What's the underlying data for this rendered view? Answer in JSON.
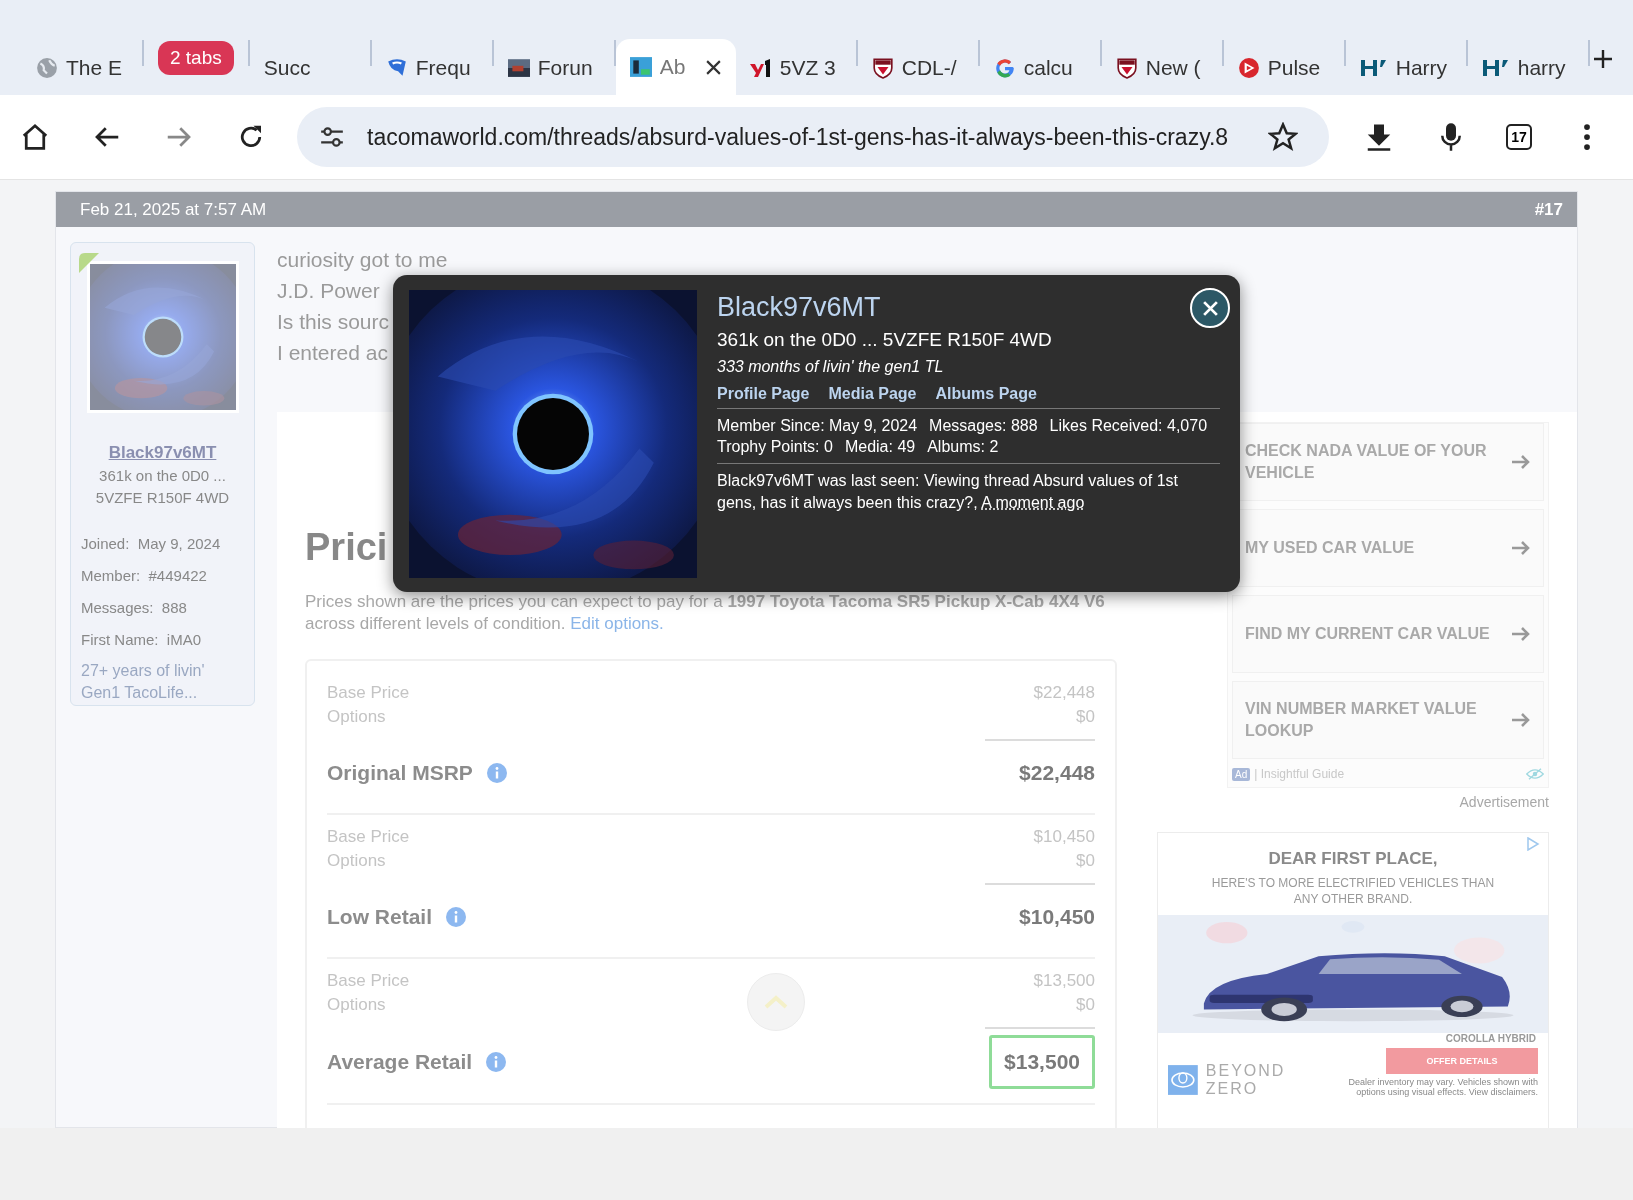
{
  "browser": {
    "tabs": [
      {
        "kind": "tab",
        "title": "The E",
        "selected": false
      },
      {
        "kind": "group",
        "title": "2 tabs",
        "color": "#d93655"
      },
      {
        "kind": "tab",
        "title": "Succ",
        "selected": false
      },
      {
        "kind": "tab",
        "title": "Frequ",
        "selected": false
      },
      {
        "kind": "tab",
        "title": "Forun",
        "selected": false
      },
      {
        "kind": "tab",
        "title": "Ab",
        "selected": true
      },
      {
        "kind": "tab",
        "title": "5VZ 3",
        "selected": false
      },
      {
        "kind": "tab",
        "title": "CDL-/",
        "selected": false
      },
      {
        "kind": "tab",
        "title": "calcu",
        "selected": false
      },
      {
        "kind": "tab",
        "title": "New (",
        "selected": false
      },
      {
        "kind": "tab",
        "title": "Pulse",
        "selected": false
      },
      {
        "kind": "tab",
        "title": "Harry",
        "selected": false
      },
      {
        "kind": "tab",
        "title": "harry",
        "selected": false
      }
    ],
    "url": "tacomaworld.com/threads/absurd-values-of-1st-gens-has-it-always-been-this-crazy.8",
    "tab_count": "17"
  },
  "post": {
    "date": "Feb 21, 2025 at 7:57 AM",
    "number": "#17",
    "user": {
      "name": "Black97v6MT",
      "title": "361k on the 0D0 ... 5VZFE R150F 4WD",
      "stats": [
        {
          "label": "Joined:",
          "value": "May 9, 2024"
        },
        {
          "label": "Member:",
          "value": "#449422"
        },
        {
          "label": "Messages:",
          "value": "888"
        },
        {
          "label": "First Name:",
          "value": "iMA0"
        }
      ],
      "custom_title": "27+ years of livin' Gen1 TacoLife..."
    },
    "lines": [
      "curiosity got to me",
      "J.D. Power",
      "Is this sourc",
      "I entered ac"
    ]
  },
  "pricing": {
    "heading": "Prici",
    "intro": "Prices shown are the prices you can expect to pay for a **1997 Toyota Tacoma SR5 Pickup X-Cab 4X4 V6** across different levels of condition.",
    "edit_link": "Edit options.",
    "groups": [
      {
        "base_label": "Base Price",
        "base": "$22,448",
        "options_label": "Options",
        "options": "$0",
        "label": "Original MSRP",
        "total": "$22,448",
        "highlighted": false
      },
      {
        "base_label": "Base Price",
        "base": "$10,450",
        "options_label": "Options",
        "options": "$0",
        "label": "Low Retail",
        "total": "$10,450",
        "highlighted": false
      },
      {
        "base_label": "Base Price",
        "base": "$13,500",
        "options_label": "Options",
        "options": "$0",
        "label": "Average Retail",
        "total": "$13,500",
        "highlighted": true
      }
    ]
  },
  "ads": {
    "links": [
      "CHECK NADA VALUE OF YOUR VEHICLE",
      "MY USED CAR VALUE",
      "FIND MY CURRENT CAR VALUE",
      "VIN NUMBER MARKET VALUE LOOKUP"
    ],
    "badge": "Ad",
    "source": "| Insightful Guide",
    "label": "Advertisement",
    "banner": {
      "headline": "DEAR FIRST PLACE,",
      "subline": "HERE'S TO MORE ELECTRIFIED VEHICLES THAN ANY OTHER BRAND.",
      "model": "COROLLA HYBRID",
      "button": "OFFER DETAILS",
      "brand": "BEYOND ZERO",
      "disclaimer": "Dealer inventory may vary. Vehicles shown with options using visual effects. View disclaimers."
    }
  },
  "popup": {
    "name": "Black97v6MT",
    "title": "361k on the 0D0 ... 5VZFE R150F 4WD",
    "custom_title": "333 months of livin' the gen1 TL",
    "links": [
      "Profile Page",
      "Media Page",
      "Albums Page"
    ],
    "stats": [
      "Member Since: May 9, 2024",
      "Messages: 888",
      "Likes Received: 4,070",
      "Trophy Points: 0",
      "Media: 49",
      "Albums: 2"
    ],
    "last_seen": "Black97v6MT was last seen: Viewing thread Absurd values of 1st gens, has it always been this crazy?,",
    "last_seen_time": "A moment ago"
  }
}
